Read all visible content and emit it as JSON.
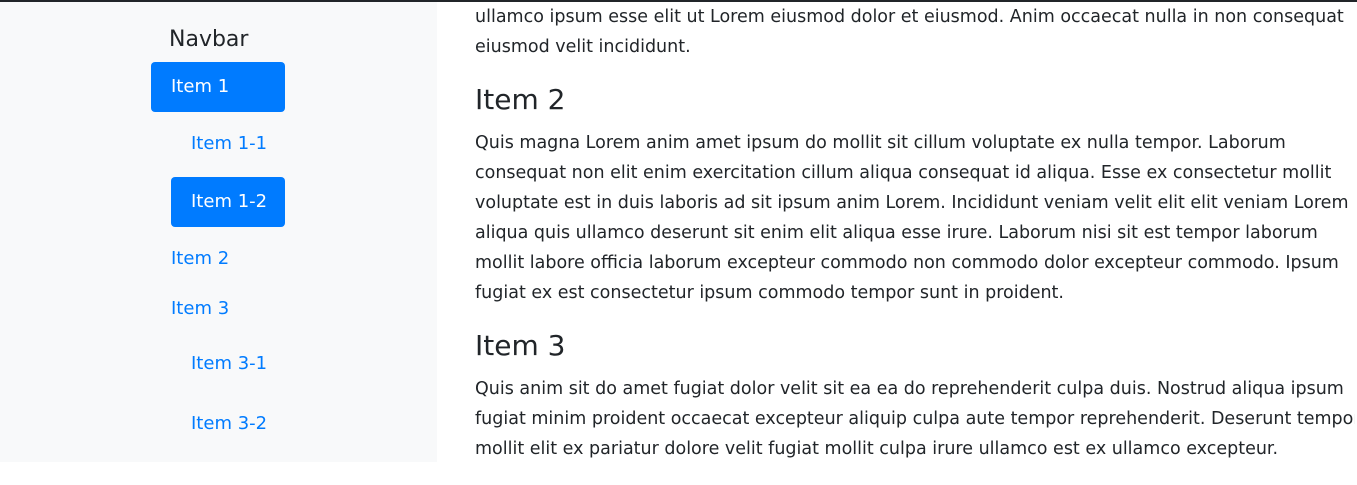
{
  "nav": {
    "brand": "Navbar",
    "items": [
      {
        "label": "Item 1",
        "active": true
      },
      {
        "label": "Item 1-1",
        "active": false
      },
      {
        "label": "Item 1-2",
        "active": true
      },
      {
        "label": "Item 2",
        "active": false
      },
      {
        "label": "Item 3",
        "active": false
      },
      {
        "label": "Item 3-1",
        "active": false
      },
      {
        "label": "Item 3-2",
        "active": false
      }
    ]
  },
  "content": {
    "intro_lines": [
      "ullamco ipsum esse elit ut Lorem eiusmod dolor et eiusmod. Anim occaecat nulla in non consequat",
      "eiusmod velit incididunt."
    ],
    "sections": [
      {
        "heading": "Item 2",
        "lines": [
          "Quis magna Lorem anim amet ipsum do mollit sit cillum voluptate ex nulla tempor. Laborum",
          "consequat non elit enim exercitation cillum aliqua consequat id aliqua. Esse ex consectetur mollit",
          "voluptate est in duis laboris ad sit ipsum anim Lorem. Incididunt veniam velit elit elit veniam Lorem",
          "aliqua quis ullamco deserunt sit enim elit aliqua esse irure. Laborum nisi sit est tempor laborum",
          "mollit labore officia laborum excepteur commodo non commodo dolor excepteur commodo. Ipsum",
          "fugiat ex est consectetur ipsum commodo tempor sunt in proident."
        ]
      },
      {
        "heading": "Item 3",
        "lines": [
          "Quis anim sit do amet fugiat dolor velit sit ea ea do reprehenderit culpa duis. Nostrud aliqua ipsum",
          "fugiat minim proident occaecat excepteur aliquip culpa aute tempor reprehenderit. Deserunt tempor",
          "mollit elit ex pariatur dolore velit fugiat mollit culpa irure ullamco est ex ullamco excepteur."
        ]
      }
    ]
  },
  "colors": {
    "accent": "#007bff",
    "sidebar_bg": "#f8f9fa",
    "text": "#212529"
  }
}
